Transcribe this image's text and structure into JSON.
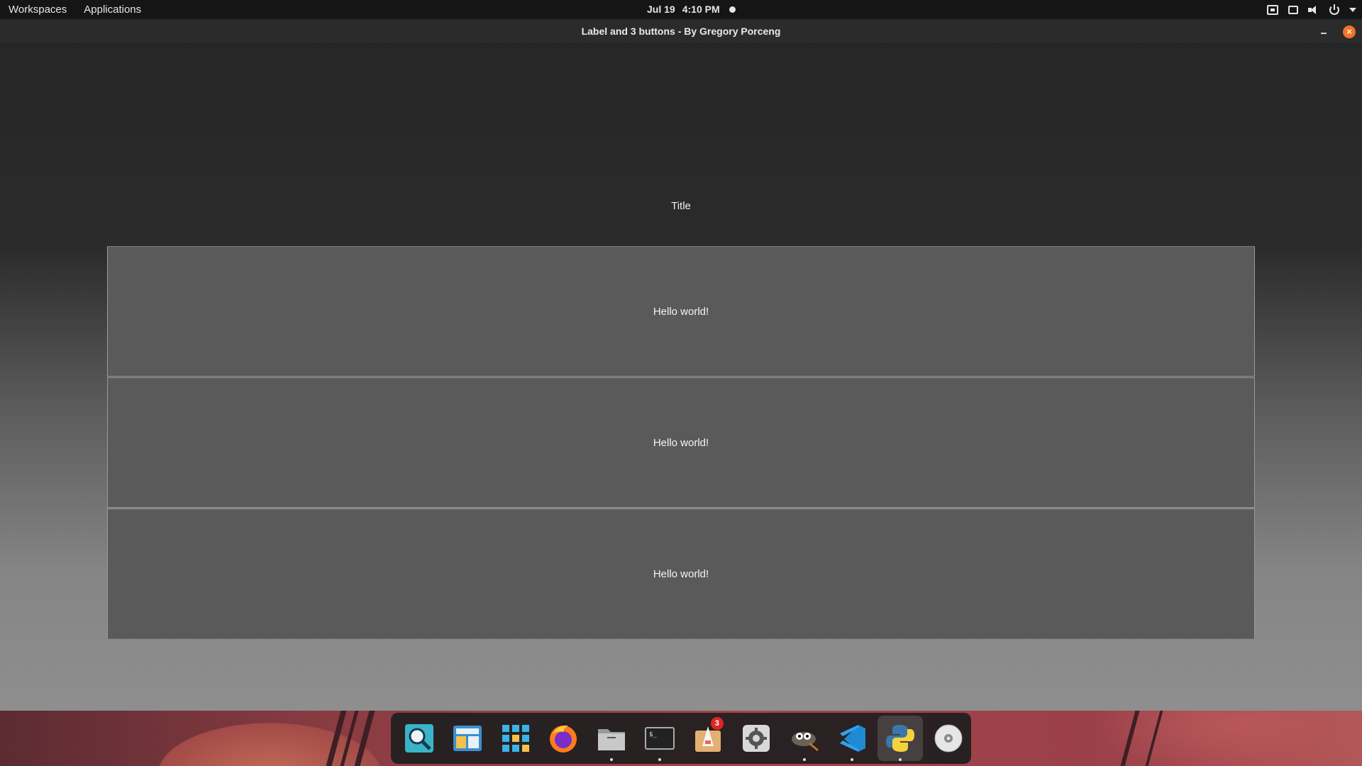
{
  "top_panel": {
    "workspaces_label": "Workspaces",
    "applications_label": "Applications",
    "date": "Jul 19",
    "time": "4:10 PM",
    "tray_icons": [
      "network-icon",
      "keyboard-icon",
      "volume-icon",
      "power-icon",
      "caret-down-icon"
    ]
  },
  "window": {
    "title": "Label and 3 buttons - By Gregory Porceng",
    "label_text": "Title",
    "buttons": [
      {
        "label": "Hello world!"
      },
      {
        "label": "Hello world!"
      },
      {
        "label": "Hello world!"
      }
    ],
    "close_glyph": "×"
  },
  "dock": {
    "items": [
      {
        "name": "search-icon",
        "running": false
      },
      {
        "name": "multitasking-view-icon",
        "running": false
      },
      {
        "name": "app-grid-icon",
        "running": false
      },
      {
        "name": "firefox-icon",
        "running": false
      },
      {
        "name": "files-icon",
        "running": true
      },
      {
        "name": "terminal-icon",
        "running": true
      },
      {
        "name": "appcenter-icon",
        "running": false,
        "badge": "3"
      },
      {
        "name": "settings-icon",
        "running": false
      },
      {
        "name": "gimp-icon",
        "running": true
      },
      {
        "name": "vscode-icon",
        "running": true
      },
      {
        "name": "python-icon",
        "running": true,
        "active": true
      },
      {
        "name": "disc-icon",
        "running": false
      }
    ]
  },
  "colors": {
    "accent_close": "#f37329",
    "badge": "#e02424",
    "button_bg": "#5a5a5a"
  }
}
